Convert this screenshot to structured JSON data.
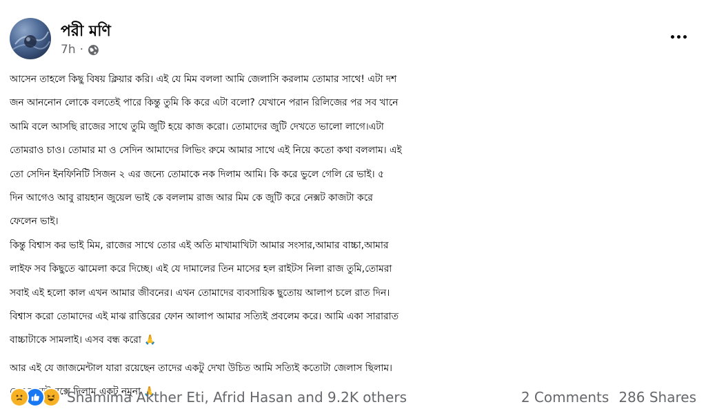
{
  "post": {
    "author": "পরী মণি",
    "time": "7h",
    "separator": "·",
    "privacy_icon": "globe-icon",
    "more_icon": "ellipsis-icon",
    "paragraphs": [
      [
        "আসেন তাহলে কিছু বিষয় ক্লিয়ার করি। এই যে মিম বললা আমি জেলাসি করলাম তোমার সাথে! এটা দশ",
        "জন আননোন লোকে বলতেই পারে কিন্তু তুমি কি করে এটা বলো? যেখানে পরান রিলিজের পর সব খানে",
        "আমি বলে আসছি রাজের সাথে তুমি জুটি হয়ে কাজ করো। তোমাদের জুটি দেখতে ভালো লাগে।এটা",
        "তোমরাও চাও। তোমার মা ও সেদিন আমাদের লিভিং রুমে আমার সাথে এই নিয়ে কতো কথা বললাম। এই",
        "তো সেদিন ইনফিনিটি সিজন ২ এর জন্যে তোমাকে নক দিলাম আমি। কি করে ভুলে গেলি রে ভাই। ৫",
        "দিন আগেও আবু রায়হান জুয়েল ভাই কে বললাম রাজ আর মিম কে জুটি করে নেক্সট কাজটা করে",
        "ফেলেন ভাই।",
        "কিন্তু বিশ্বাস কর ভাই মিম, রাজের সাথে তোর এই অতি মাখামাখিটা আমার সংসার,আমার বাচ্চা,আমার",
        "লাইফ সব কিছুতে ঝামেলা করে দিচ্ছে। এই যে দামালের তিন মাসের হল রাইটস নিলা রাজ তুমি,তোমরা",
        "সবাই এই হলো কাল এখন আমার জীবনের। এখন তোমাদের ব্যবসায়িক ছুতোয় আলাপ চলে রাত দিন।",
        "বিশ্বাস করো তোমাদের এই মাঝ রাত্তিরের ফোন আলাপ আমার সত্যিই প্রবলেম করে। আমি একা সারারাত",
        "বাচ্চাটাকে সামলাই। এসব বন্ধ করো 🙏"
      ],
      [
        "আর এই যে জাজমেন্টাল যারা রয়েছেন তাদের একটু দেখা উচিত আমি সত্যিই কতোটা জেলাস ছিলাম।",
        "নেন কমেন্ট বক্সে দিলাম একটু নমুনা 🙏"
      ]
    ]
  },
  "footer": {
    "reaction_icons": [
      "sad-icon",
      "like-icon",
      "haha-icon"
    ],
    "reaction_names": "Shamima Akther Eti, Afrid Hasan and 9.2K others",
    "comments": "2 Comments",
    "shares": "286 Shares"
  },
  "colors": {
    "text": "#050505",
    "secondary": "#65676b",
    "like_blue": "#1877f2",
    "reaction_yellow": "#f7b125"
  }
}
